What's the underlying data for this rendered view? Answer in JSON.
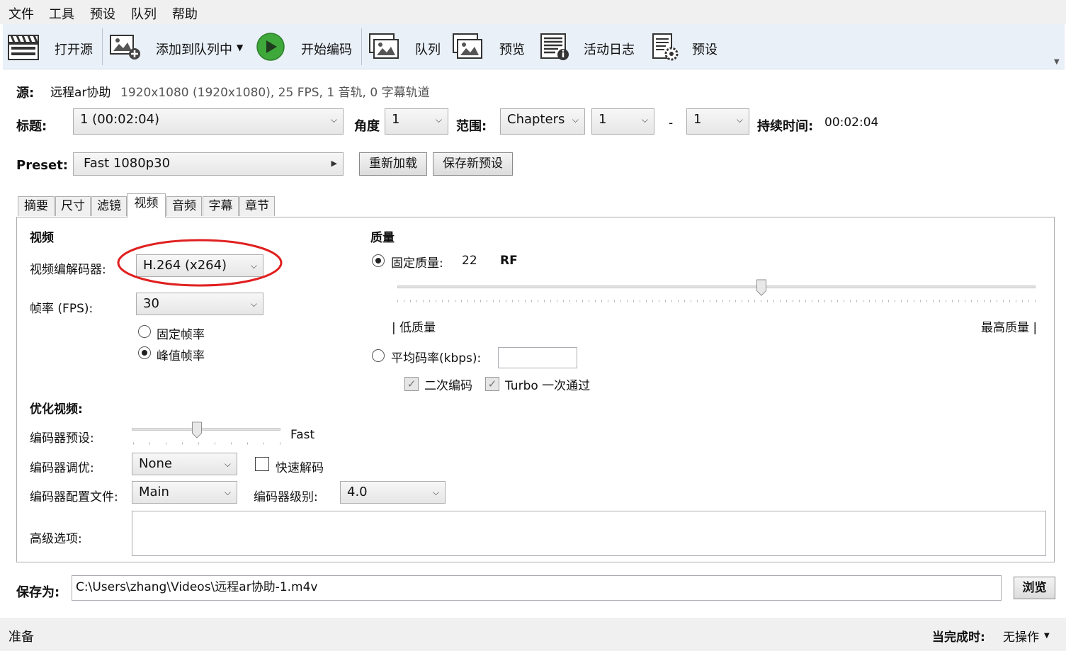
{
  "menu": {
    "file": "文件",
    "tools": "工具",
    "presets": "预设",
    "queue": "队列",
    "help": "帮助"
  },
  "toolbar": {
    "open_source": "打开源",
    "add_to_queue": "添加到队列中",
    "start_encode": "开始编码",
    "queue": "队列",
    "preview": "预览",
    "activity_log": "活动日志",
    "presets": "预设"
  },
  "source": {
    "label": "源:",
    "name": "远程ar协助",
    "info": "1920x1080 (1920x1080), 25 FPS, 1 音轨, 0 字幕轨道"
  },
  "title_row": {
    "title_label": "标题:",
    "title_value": "1  (00:02:04)",
    "angle_label": "角度",
    "angle_value": "1",
    "range_label": "范围:",
    "range_type": "Chapters",
    "range_start": "1",
    "range_dash": "-",
    "range_end": "1",
    "duration_label": "持续时间:",
    "duration_value": "00:02:04"
  },
  "preset": {
    "label": "Preset:",
    "value": "Fast 1080p30",
    "reload": "重新加载",
    "save_new": "保存新预设"
  },
  "tabs": [
    "摘要",
    "尺寸",
    "滤镜",
    "视频",
    "音频",
    "字幕",
    "章节"
  ],
  "video": {
    "heading": "视频",
    "codec_label": "视频编解码器:",
    "codec_value": "H.264 (x264)",
    "fps_label": "帧率 (FPS):",
    "fps_value": "30",
    "constant_fr": "固定帧率",
    "peak_fr": "峰值帧率"
  },
  "quality": {
    "heading": "质量",
    "cq_label": "固定质量:",
    "cq_value": "22",
    "cq_unit": "RF",
    "cq_level": 0.57,
    "low": "| 低质量",
    "high": "最高质量 |",
    "abr_label": "平均码率(kbps):",
    "abr_value": "",
    "two_pass": "二次编码",
    "turbo": "Turbo 一次通过"
  },
  "optimize": {
    "heading": "优化视频:",
    "preset_label": "编码器预设:",
    "preset_value": "Fast",
    "preset_level": 0.44,
    "tune_label": "编码器调优:",
    "tune_value": "None",
    "fast_decode": "快速解码",
    "profile_label": "编码器配置文件:",
    "profile_value": "Main",
    "level_label": "编码器级别:",
    "level_value": "4.0",
    "advanced_label": "高级选项:",
    "advanced_value": ""
  },
  "save": {
    "label": "保存为:",
    "path": "C:\\Users\\zhang\\Videos\\远程ar协助-1.m4v",
    "browse": "浏览"
  },
  "status": {
    "ready": "准备",
    "when_done_label": "当完成时:",
    "when_done_value": "无操作"
  },
  "colors": {
    "toolbar_bg": "#e9f0f8",
    "highlight_red": "#e02020",
    "play_green": "#3ea83a"
  }
}
